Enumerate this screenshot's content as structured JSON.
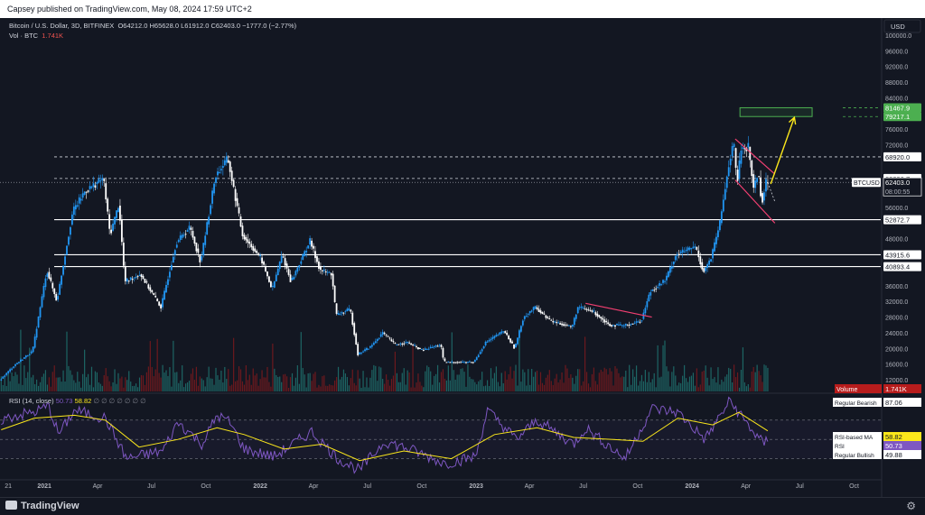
{
  "header": {
    "published": "Capsey published on TradingView.com, May 08, 2024 17:59 UTC+2"
  },
  "chart_header": {
    "symbol": "Bitcoin / U.S. Dollar, 3D, BITFINEX",
    "ohlc": "O64212.0  H65628.0  L61912.0  C62403.0  −1777.0 (−2.77%)",
    "vol_label": "Vol · BTC",
    "vol_value": "1.741K"
  },
  "rsi_header": {
    "label": "RSI (14, close)",
    "value1": "50.73",
    "value2": "58.82",
    "placeholders": "∅ ∅ ∅ ∅ ∅ ∅ ∅"
  },
  "currency_button": "USD",
  "footer": {
    "brand": "TradingView"
  },
  "colors": {
    "background": "#131722",
    "up_candle": "#2196f3",
    "down_candle": "#ffffff",
    "trend_lines": "#f23f71",
    "projection": "#fbe71b",
    "target_box": "#4caf50",
    "rsi_line": "#7e57c2",
    "rsi_ma": "#fbe71b",
    "vol_up": "#26a69a",
    "vol_down": "#b71c1c"
  },
  "chart_data": {
    "type": "candlestick",
    "pair": "BTCUSD",
    "timeframe": "3D",
    "y_axis_ticks": [
      12000,
      16000,
      20000,
      24000,
      28000,
      32000,
      36000,
      40000,
      44000,
      48000,
      52000,
      56000,
      60000,
      64000,
      68000,
      72000,
      76000,
      80000,
      84000,
      88000,
      92000,
      96000,
      100000
    ],
    "y_axis_labels": [
      "12000.0",
      "16000.0",
      "20000.0",
      "24000.0",
      "28000.0",
      "32000.0",
      "36000.0",
      "40000.0",
      "44000.0",
      "48000.0",
      "52000.0",
      "56000.0",
      "60000.0",
      "64000.0",
      "68000.0",
      "72000.0",
      "76000.0",
      "80000.0",
      "84000.0",
      "88000.0",
      "92000.0",
      "96000.0",
      "100000.0"
    ],
    "ylim": [
      9000,
      103000
    ],
    "x_axis_labels": [
      "21",
      "2021",
      "Apr",
      "Jul",
      "Oct",
      "2022",
      "Apr",
      "Jul",
      "Oct",
      "2023",
      "Apr",
      "Jul",
      "Oct",
      "2024",
      "Apr",
      "Jul",
      "Oct"
    ],
    "x_axis_dates": [
      "2020-11",
      "2021-01",
      "2021-04",
      "2021-07",
      "2021-10",
      "2022-01",
      "2022-04",
      "2022-07",
      "2022-10",
      "2023-01",
      "2023-04",
      "2023-07",
      "2023-10",
      "2024-01",
      "2024-04",
      "2024-07",
      "2024-10"
    ],
    "xlim": [
      "2020-10-18",
      "2024-11-15"
    ],
    "price_path": [
      [
        "2020-10-20",
        11800
      ],
      [
        "2020-11-15",
        15800
      ],
      [
        "2020-12-15",
        19300
      ],
      [
        "2021-01-08",
        40000
      ],
      [
        "2021-01-25",
        32000
      ],
      [
        "2021-02-21",
        55000
      ],
      [
        "2021-03-13",
        60000
      ],
      [
        "2021-04-14",
        63500
      ],
      [
        "2021-04-25",
        49000
      ],
      [
        "2021-05-10",
        57000
      ],
      [
        "2021-05-20",
        37000
      ],
      [
        "2021-06-15",
        39000
      ],
      [
        "2021-07-20",
        30500
      ],
      [
        "2021-08-15",
        47000
      ],
      [
        "2021-09-07",
        51000
      ],
      [
        "2021-09-25",
        42000
      ],
      [
        "2021-10-20",
        64000
      ],
      [
        "2021-11-10",
        68500
      ],
      [
        "2021-12-05",
        49000
      ],
      [
        "2022-01-05",
        43000
      ],
      [
        "2022-01-24",
        35000
      ],
      [
        "2022-02-10",
        44000
      ],
      [
        "2022-02-25",
        37000
      ],
      [
        "2022-03-29",
        47500
      ],
      [
        "2022-04-15",
        40000
      ],
      [
        "2022-05-05",
        39000
      ],
      [
        "2022-05-12",
        28500
      ],
      [
        "2022-06-05",
        30000
      ],
      [
        "2022-06-18",
        18500
      ],
      [
        "2022-07-10",
        20500
      ],
      [
        "2022-07-30",
        24000
      ],
      [
        "2022-08-20",
        21000
      ],
      [
        "2022-09-10",
        21500
      ],
      [
        "2022-10-05",
        19500
      ],
      [
        "2022-11-05",
        21000
      ],
      [
        "2022-11-10",
        16500
      ],
      [
        "2022-12-31",
        16500
      ],
      [
        "2023-01-20",
        21500
      ],
      [
        "2023-02-20",
        24500
      ],
      [
        "2023-03-10",
        20000
      ],
      [
        "2023-03-25",
        28000
      ],
      [
        "2023-04-14",
        30500
      ],
      [
        "2023-05-10",
        27000
      ],
      [
        "2023-06-15",
        25500
      ],
      [
        "2023-06-25",
        30500
      ],
      [
        "2023-07-20",
        29500
      ],
      [
        "2023-08-17",
        26000
      ],
      [
        "2023-09-10",
        25800
      ],
      [
        "2023-10-10",
        27000
      ],
      [
        "2023-10-25",
        34500
      ],
      [
        "2023-11-20",
        37500
      ],
      [
        "2023-12-08",
        44000
      ],
      [
        "2024-01-10",
        46000
      ],
      [
        "2024-01-23",
        39500
      ],
      [
        "2024-02-05",
        43000
      ],
      [
        "2024-02-20",
        52000
      ],
      [
        "2024-03-05",
        66000
      ],
      [
        "2024-03-14",
        73000
      ],
      [
        "2024-03-20",
        62000
      ],
      [
        "2024-03-27",
        71000
      ],
      [
        "2024-04-08",
        71500
      ],
      [
        "2024-04-17",
        61000
      ],
      [
        "2024-04-25",
        65000
      ],
      [
        "2024-05-01",
        57000
      ],
      [
        "2024-05-08",
        62403
      ]
    ],
    "horizontal_levels": [
      {
        "value": 81467.9,
        "label": "81467.9",
        "style": "dashed",
        "color": "#4caf50"
      },
      {
        "value": 79217.1,
        "label": "79217.1",
        "style": "dashed",
        "color": "#4caf50"
      },
      {
        "value": 68920.0,
        "label": "68920.0",
        "style": "dashed",
        "color": "#d1d4dc"
      },
      {
        "value": 63396.7,
        "label": "63396.7",
        "style": "dashed",
        "color": "#d1d4dc"
      },
      {
        "value": 52872.7,
        "label": "52872.7",
        "style": "solid",
        "color": "#ffffff"
      },
      {
        "value": 43915.6,
        "label": "43915.6",
        "style": "solid",
        "color": "#ffffff"
      },
      {
        "value": 40893.4,
        "label": "40893.4",
        "style": "solid",
        "color": "#ffffff"
      }
    ],
    "current_price": {
      "symbol": "BTCUSD",
      "value": 62403.0,
      "label": "62403.0",
      "countdown": "08:00:55"
    },
    "target_zone": {
      "from_date": "2024-03-22",
      "to_date": "2024-07-22",
      "low": 79217.1,
      "high": 81467.9
    },
    "projection": [
      [
        "2024-05-13",
        62000
      ],
      [
        "2024-06-22",
        79000
      ]
    ],
    "downtrend_channels": [
      {
        "upper": [
          [
            "2024-03-14",
            73500
          ],
          [
            "2024-05-20",
            64500
          ]
        ],
        "lower": [
          [
            "2024-03-14",
            63000
          ],
          [
            "2024-05-20",
            52000
          ]
        ]
      },
      {
        "upper": [
          [
            "2023-07-05",
            31500
          ],
          [
            "2023-10-25",
            28000
          ]
        ]
      }
    ],
    "volume": {
      "label": "Volume",
      "value": "1.741K"
    },
    "rsi": {
      "label": "RSI (14, close)",
      "ylim": [
        10,
        95
      ],
      "levels": [
        70,
        50,
        30
      ],
      "rsi_path": [
        [
          "2020-10-20",
          70
        ],
        [
          "2020-11-15",
          75
        ],
        [
          "2020-12-15",
          78
        ],
        [
          "2021-01-08",
          85
        ],
        [
          "2021-01-25",
          55
        ],
        [
          "2021-02-21",
          80
        ],
        [
          "2021-04-14",
          72
        ],
        [
          "2021-05-20",
          30
        ],
        [
          "2021-07-20",
          38
        ],
        [
          "2021-08-15",
          68
        ],
        [
          "2021-09-25",
          45
        ],
        [
          "2021-10-20",
          75
        ],
        [
          "2021-11-10",
          68
        ],
        [
          "2021-12-05",
          40
        ],
        [
          "2022-01-24",
          32
        ],
        [
          "2022-03-29",
          58
        ],
        [
          "2022-05-12",
          30
        ],
        [
          "2022-06-18",
          18
        ],
        [
          "2022-07-30",
          48
        ],
        [
          "2022-09-10",
          40
        ],
        [
          "2022-11-10",
          25
        ],
        [
          "2022-12-31",
          32
        ],
        [
          "2023-01-20",
          80
        ],
        [
          "2023-03-10",
          50
        ],
        [
          "2023-04-14",
          70
        ],
        [
          "2023-06-15",
          45
        ],
        [
          "2023-07-05",
          62
        ],
        [
          "2023-09-10",
          30
        ],
        [
          "2023-10-25",
          82
        ],
        [
          "2023-12-08",
          78
        ],
        [
          "2024-01-23",
          50
        ],
        [
          "2024-03-05",
          90
        ],
        [
          "2024-04-17",
          55
        ],
        [
          "2024-05-01",
          45
        ],
        [
          "2024-05-08",
          50.73
        ]
      ],
      "ma_path": [
        [
          "2020-10-20",
          60
        ],
        [
          "2020-12-15",
          72
        ],
        [
          "2021-02-21",
          75
        ],
        [
          "2021-04-14",
          70
        ],
        [
          "2021-06-10",
          42
        ],
        [
          "2021-08-15",
          50
        ],
        [
          "2021-10-20",
          62
        ],
        [
          "2021-12-05",
          55
        ],
        [
          "2022-02-10",
          40
        ],
        [
          "2022-04-15",
          45
        ],
        [
          "2022-06-18",
          28
        ],
        [
          "2022-09-01",
          38
        ],
        [
          "2022-11-20",
          30
        ],
        [
          "2023-02-01",
          55
        ],
        [
          "2023-04-14",
          62
        ],
        [
          "2023-06-15",
          52
        ],
        [
          "2023-08-20",
          50
        ],
        [
          "2023-10-10",
          48
        ],
        [
          "2023-12-08",
          72
        ],
        [
          "2024-02-05",
          65
        ],
        [
          "2024-03-20",
          78
        ],
        [
          "2024-05-08",
          58.82
        ]
      ],
      "rsi_value": "50.73",
      "ma_value": "58.82",
      "labels": [
        {
          "text": "Regular Bearish",
          "value": "87.06"
        },
        {
          "text": "RSI-based MA",
          "value": "58.82"
        },
        {
          "text": "RSI",
          "value": "50.73"
        },
        {
          "text": "Regular Bullish",
          "value": "49.88"
        }
      ]
    }
  }
}
